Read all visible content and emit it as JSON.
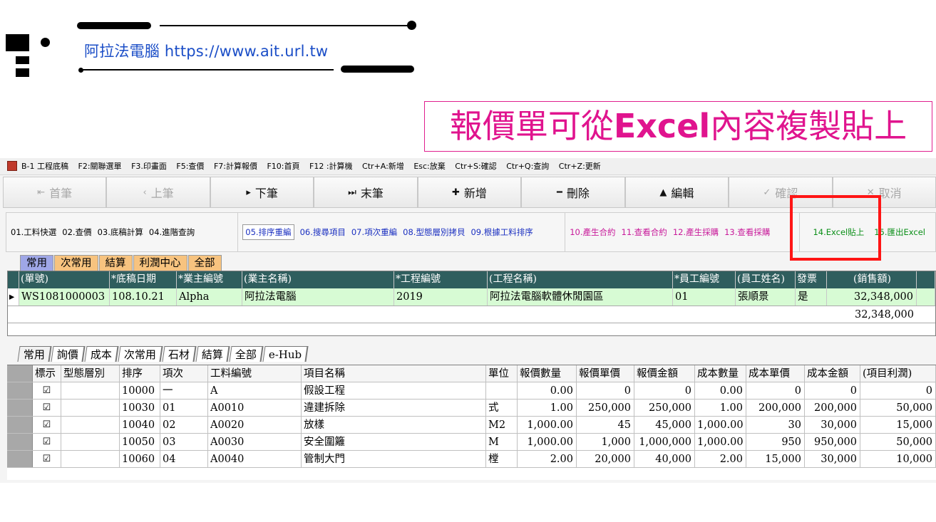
{
  "branding": {
    "text": "阿拉法電腦 https://www.ait.url.tw",
    "headline_prefix": "報價單可從",
    "headline_bold": "Excel",
    "headline_suffix": "內容複製貼上"
  },
  "titlebar": {
    "title": "B-1 工程底稿",
    "shortcuts": [
      "F2:關聯選單",
      "F3.印畫面",
      "F5:查價",
      "F7:計算報價",
      "F10:首頁",
      "F12 :計算機",
      "Ctr+A:新增",
      "Esc:放棄",
      "Ctr+S:確認",
      "Ctr+Q:查詢",
      "Ctr+Z:更新"
    ]
  },
  "toolbar": {
    "first": "首筆",
    "prev": "上筆",
    "next": "下筆",
    "last": "末筆",
    "add": "新增",
    "delete": "刪除",
    "edit": "編輯",
    "confirm": "確認",
    "cancel": "取消"
  },
  "functions": {
    "group1": [
      "01.工料快選",
      "02.查價",
      "03.底稿計算",
      "04.進階查詢"
    ],
    "group2": [
      "05.排序重編",
      "06.搜尋項目",
      "07.項次重編",
      "08.型態層別拷貝",
      "09.根據工料排序"
    ],
    "group3": [
      "10.產生合約",
      "11.查看合約",
      "12.產生採購",
      "13.查看採購"
    ],
    "group4": [
      "14.Excel貼上",
      "15.匯出Excel"
    ]
  },
  "upper_tabs": [
    "常用",
    "次常用",
    "結算",
    "利潤中心",
    "全部"
  ],
  "upper_grid": {
    "headers": [
      "(單號)",
      "*底稿日期",
      "*業主編號",
      "(業主名稱)",
      "*工程編號",
      "(工程名稱)",
      "*員工編號",
      "(員工姓名)",
      "發票",
      "(銷售額)"
    ],
    "row": [
      "WS1081000003",
      "108.10.21",
      "Alpha",
      "阿拉法電腦",
      "2019",
      "阿拉法電腦軟體休閒園區",
      "01",
      "張順景",
      "是",
      "32,348,000"
    ],
    "total": "32,348,000"
  },
  "lower_tabs": [
    "常用",
    "詢價",
    "成本",
    "次常用",
    "石材",
    "結算",
    "全部",
    "e-Hub"
  ],
  "lower_grid": {
    "headers": [
      "標示",
      "型態層別",
      "排序",
      "項次",
      "工料編號",
      "項目名稱",
      "單位",
      "報價數量",
      "報價單價",
      "報價金額",
      "成本數量",
      "成本單價",
      "成本金額",
      "(項目利潤)"
    ],
    "rows": [
      [
        "☑",
        "",
        "10000",
        "一",
        "A",
        "假設工程",
        "",
        "0.00",
        "0",
        "0",
        "0.00",
        "0",
        "0",
        "0"
      ],
      [
        "☑",
        "",
        "10030",
        "01",
        "A0010",
        "違建拆除",
        "式",
        "1.00",
        "250,000",
        "250,000",
        "1.00",
        "200,000",
        "200,000",
        "50,000"
      ],
      [
        "☑",
        "",
        "10040",
        "02",
        "A0020",
        "放樣",
        "M2",
        "1,000.00",
        "45",
        "45,000",
        "1,000.00",
        "30",
        "30,000",
        "15,000"
      ],
      [
        "☑",
        "",
        "10050",
        "03",
        "A0030",
        "安全圍籬",
        "M",
        "1,000.00",
        "1,000",
        "1,000,000",
        "1,000.00",
        "950",
        "950,000",
        "50,000"
      ],
      [
        "☑",
        "",
        "10060",
        "04",
        "A0040",
        "管制大門",
        "樘",
        "2.00",
        "20,000",
        "40,000",
        "2.00",
        "15,000",
        "30,000",
        "10,000"
      ]
    ]
  }
}
